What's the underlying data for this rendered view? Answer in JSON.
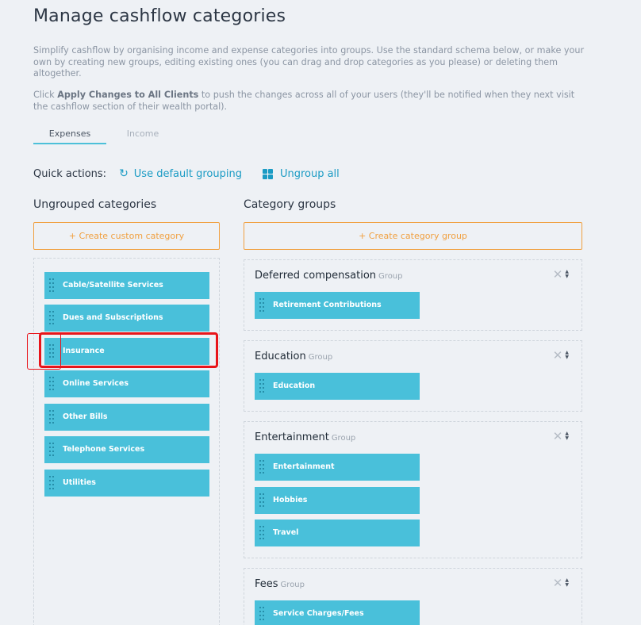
{
  "page": {
    "title": "Manage cashflow categories",
    "description_1": "Simplify cashflow by organising income and expense categories into groups. Use the standard schema below, or make your own by creating new groups, editing existing ones (you can drag and drop categories as you please) or deleting them altogether.",
    "description_2_prefix": "Click ",
    "description_2_bold": "Apply Changes to All Clients",
    "description_2_suffix": " to push the changes across all of your users (they'll be notified when they next visit the cashflow section of their wealth portal)."
  },
  "tabs": [
    {
      "label": "Expenses",
      "active": true
    },
    {
      "label": "Income",
      "active": false
    }
  ],
  "quick_actions": {
    "label": "Quick actions:",
    "use_default": "Use default grouping",
    "ungroup_all": "Ungroup all"
  },
  "ungrouped": {
    "heading": "Ungrouped categories",
    "create_label": "+ Create custom category",
    "items": [
      "Cable/Satellite Services",
      "Dues and Subscriptions",
      "Insurance",
      "Online Services",
      "Other Bills",
      "Telephone Services",
      "Utilities"
    ]
  },
  "groups_panel": {
    "heading": "Category groups",
    "create_label": "+ Create category group",
    "group_suffix": "Group",
    "groups": [
      {
        "name": "Deferred compensation",
        "items": [
          "Retirement Contributions"
        ]
      },
      {
        "name": "Education",
        "items": [
          "Education"
        ]
      },
      {
        "name": "Entertainment",
        "items": [
          "Entertainment",
          "Hobbies",
          "Travel"
        ]
      },
      {
        "name": "Fees",
        "items": [
          "Service Charges/Fees"
        ]
      }
    ]
  },
  "colors": {
    "accent": "#49c0da",
    "link": "#1a9bc4",
    "create_button": "#f0a040",
    "highlight": "#e8141a"
  },
  "icons": {
    "use_default": "refresh-icon",
    "ungroup_all": "grid-icon",
    "drag": "drag-handle-icon",
    "remove": "close-icon",
    "sort": "sort-icon"
  }
}
